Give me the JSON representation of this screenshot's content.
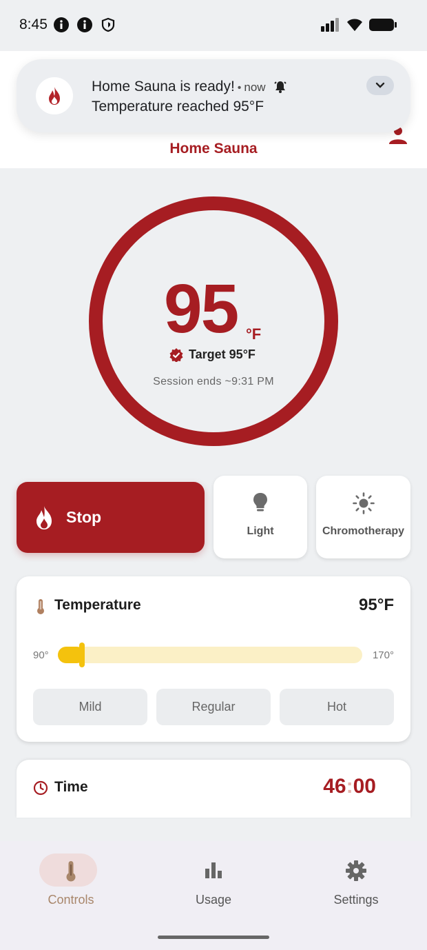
{
  "status_bar": {
    "time": "8:45"
  },
  "notification": {
    "title": "Home Sauna is ready!",
    "time": "now",
    "body": "Temperature reached 95°F"
  },
  "header": {
    "title": "Home Sauna"
  },
  "gauge": {
    "current_temp": "95",
    "unit": "°F",
    "target": "Target 95°F",
    "session": "Session ends ~9:31 PM"
  },
  "actions": {
    "stop_label": "Stop",
    "light_label": "Light",
    "chromotherapy_label": "Chromotherapy"
  },
  "temperature_card": {
    "title": "Temperature",
    "value": "95°F",
    "min_label": "90°",
    "max_label": "170°",
    "slider_fraction": 0.06,
    "presets": [
      "Mild",
      "Regular",
      "Hot"
    ]
  },
  "time_card": {
    "title": "Time",
    "minutes": "46",
    "separator": ":",
    "seconds": "00"
  },
  "nav": {
    "items": [
      {
        "label": "Controls",
        "active": true
      },
      {
        "label": "Usage",
        "active": false
      },
      {
        "label": "Settings",
        "active": false
      }
    ]
  },
  "colors": {
    "brand": "#a61d22",
    "slider": "#f4c20d",
    "slider_track": "#fbf0c6",
    "nav_active": "#a8866a"
  }
}
